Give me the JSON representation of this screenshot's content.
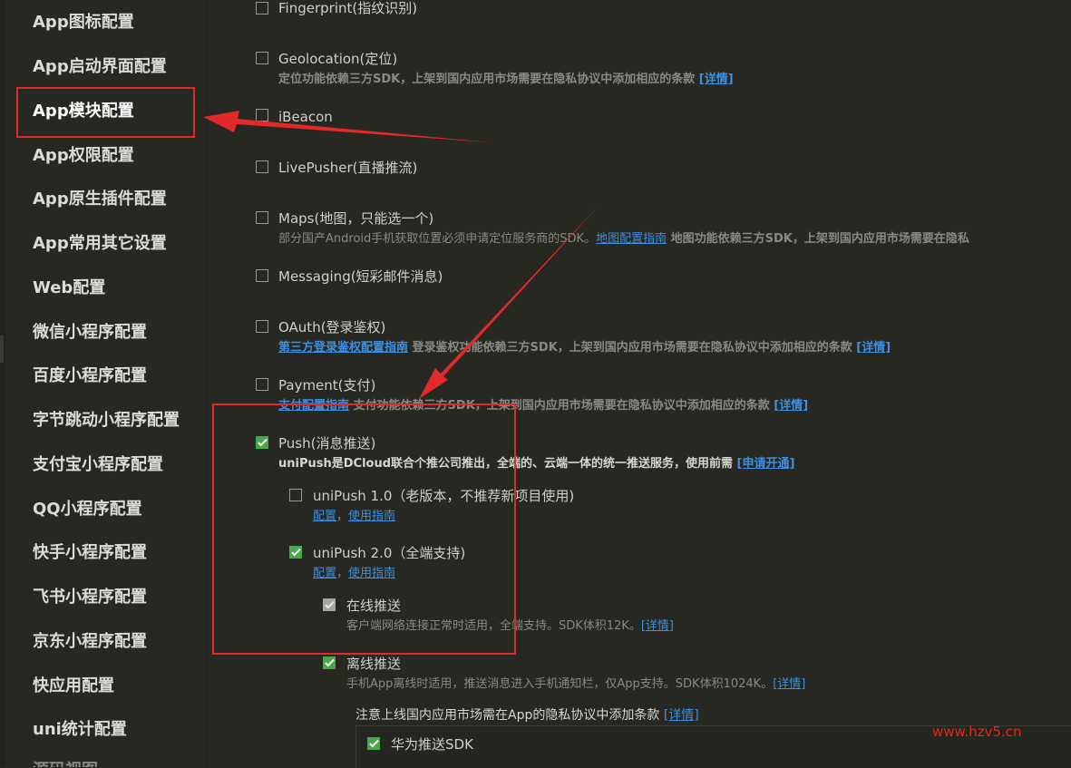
{
  "sidebar": {
    "items": [
      {
        "label": "App图标配置"
      },
      {
        "label": "App启动界面配置"
      },
      {
        "label": "App模块配置"
      },
      {
        "label": "App权限配置"
      },
      {
        "label": "App原生插件配置"
      },
      {
        "label": "App常用其它设置"
      },
      {
        "label": "Web配置"
      },
      {
        "label": "微信小程序配置"
      },
      {
        "label": "百度小程序配置"
      },
      {
        "label": "字节跳动小程序配置"
      },
      {
        "label": "支付宝小程序配置"
      },
      {
        "label": "QQ小程序配置"
      },
      {
        "label": "快手小程序配置"
      },
      {
        "label": "飞书小程序配置"
      },
      {
        "label": "京东小程序配置"
      },
      {
        "label": "快应用配置"
      },
      {
        "label": "uni统计配置"
      }
    ],
    "selected": "App模块配置"
  },
  "modules": {
    "fingerprint": {
      "label": "Fingerprint(指纹识别)",
      "checked": false
    },
    "geolocation": {
      "label": "Geolocation(定位)",
      "checked": false,
      "desc": "定位功能依赖三方SDK，上架到国内应用市场需要在隐私协议中添加相应的条款",
      "link": "[详情]"
    },
    "ibeacon": {
      "label": "iBeacon",
      "checked": false
    },
    "livepusher": {
      "label": "LivePusher(直播推流)",
      "checked": false
    },
    "maps": {
      "label": "Maps(地图，只能选一个)",
      "checked": false,
      "desc1": "部分国产Android手机获取位置必须申请定位服务商的SDK。",
      "link": "地图配置指南",
      "desc2": " 地图功能依赖三方SDK，上架到国内应用市场需要在隐私"
    },
    "messaging": {
      "label": "Messaging(短彩邮件消息)",
      "checked": false
    },
    "oauth": {
      "label": "OAuth(登录鉴权)",
      "checked": false,
      "link1": "第三方登录鉴权配置指南",
      "desc": " 登录鉴权功能依赖三方SDK，上架到国内应用市场需要在隐私协议中添加相应的条款 ",
      "link2": "[详情]"
    },
    "payment": {
      "label": "Payment(支付)",
      "checked": false,
      "link1": "支付配置指南",
      "desc": " 支付功能依赖三方SDK，上架到国内应用市场需要在隐私协议中添加相应的条款 ",
      "link2": "[详情]"
    },
    "push": {
      "label": "Push(消息推送)",
      "checked": true,
      "desc": "uniPush是DCloud联合个推公司推出，全端的、云端一体的统一推送服务，使用前需 ",
      "link": "[申请开通]",
      "unipush1": {
        "label": "uniPush 1.0（老版本，不推荐新项目使用)",
        "checked": false,
        "link_config": "配置",
        "sep": "，",
        "link_guide": "使用指南"
      },
      "unipush2": {
        "label": "uniPush 2.0（全端支持)",
        "checked": true,
        "link_config": "配置",
        "sep": "，",
        "link_guide": "使用指南",
        "online": {
          "label": "在线推送",
          "checked": true,
          "disabled": true,
          "desc": "客户端网络连接正常时适用，全端支持。SDK体积12K。",
          "link": "[详情]"
        },
        "offline": {
          "label": "离线推送",
          "checked": true,
          "desc": "手机App离线时适用，推送消息进入手机通知栏，仅App支持。SDK体积1024K。",
          "link": "[详情]"
        },
        "notice": {
          "text": "注意上线国内应用市场需在App的隐私协议中添加条款 ",
          "link": "[详情]"
        },
        "huawei": {
          "label": "华为推送SDK",
          "checked": true
        }
      }
    }
  },
  "watermark": "www.hzv5.cn",
  "colors": {
    "background": "#272822",
    "accent_green": "#49a94a",
    "link_blue": "#3d8fe0",
    "annotation_red": "#e32a2a"
  }
}
